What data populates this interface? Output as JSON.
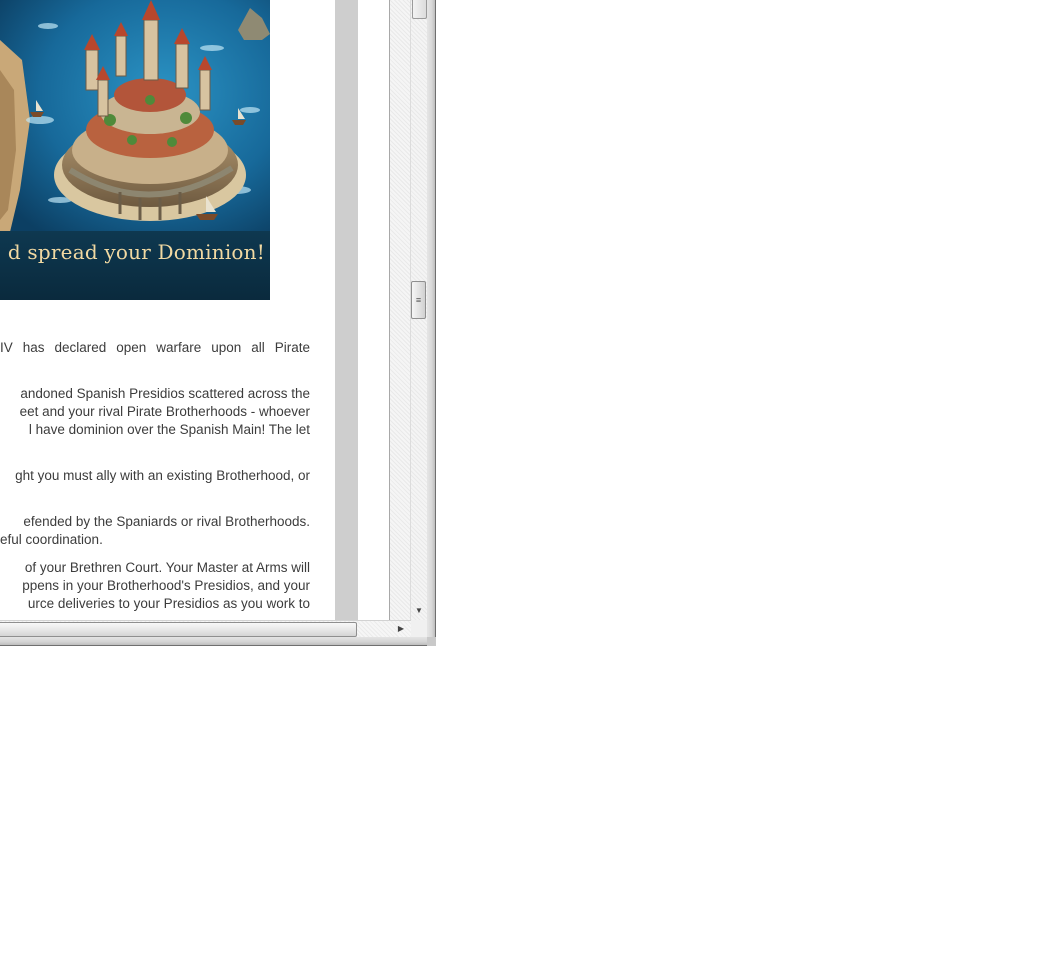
{
  "banner": {
    "image_alt": "Island fortress surrounded by sea",
    "caption": "d spread your Dominion!"
  },
  "article": {
    "paragraphs": [
      {
        "lines": [
          "IV  has  declared  open  warfare  upon  all  Pirate"
        ]
      },
      {
        "lines": [
          "andoned Spanish Presidios scattered across the",
          "eet and your rival Pirate Brotherhoods - whoever",
          "l have dominion over the Spanish Main! The let"
        ]
      },
      {
        "lines": [
          "ght you must ally with an existing Brotherhood, or"
        ]
      },
      {
        "lines": [
          "efended by the Spaniards or rival Brotherhoods.",
          "eful coordination."
        ]
      },
      {
        "lines": [
          "of your Brethren Court. Your Master at Arms will",
          "ppens in your Brotherhood's Presidios, and your",
          "urce deliveries to your Presidios as you work to"
        ]
      }
    ]
  },
  "scrollbars": {
    "vertical": {
      "thumb_glyph": "≡",
      "down_arrow": "▼",
      "position": 0.48
    },
    "horizontal": {
      "right_arrow": "▶",
      "position": 1.0
    }
  },
  "colors": {
    "body_text": "#3c3c3c",
    "caption_text": "#f1d9a2",
    "sea": "#1b6b96"
  }
}
